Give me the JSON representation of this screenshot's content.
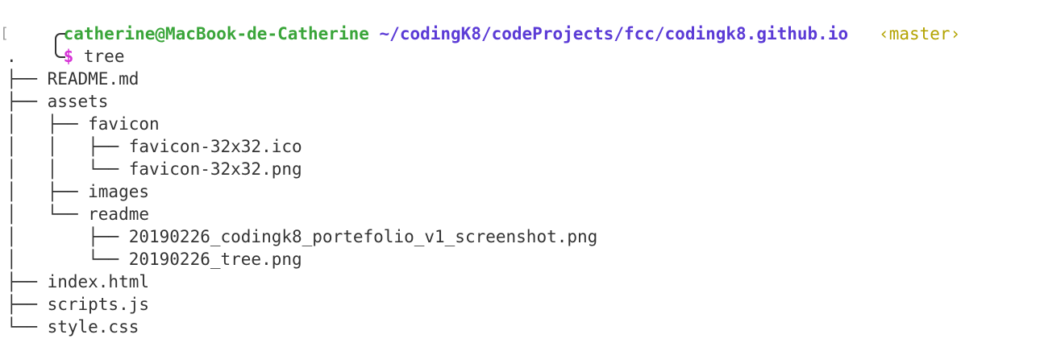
{
  "prompt": {
    "user_host": "catherine@MacBook-de-Catherine",
    "path": "~/codingK8/codeProjects/fcc/codingk8.github.io",
    "branch": "‹master›",
    "symbol": "$",
    "command": "tree",
    "bracket": "["
  },
  "tree_lines": [
    ".",
    "├── README.md",
    "├── assets",
    "│   ├── favicon",
    "│   │   ├── favicon-32x32.ico",
    "│   │   └── favicon-32x32.png",
    "│   ├── images",
    "│   └── readme",
    "│       ├── 20190226_codingk8_portefolio_v1_screenshot.png",
    "│       └── 20190226_tree.png",
    "├── index.html",
    "├── scripts.js",
    "└── style.css"
  ]
}
